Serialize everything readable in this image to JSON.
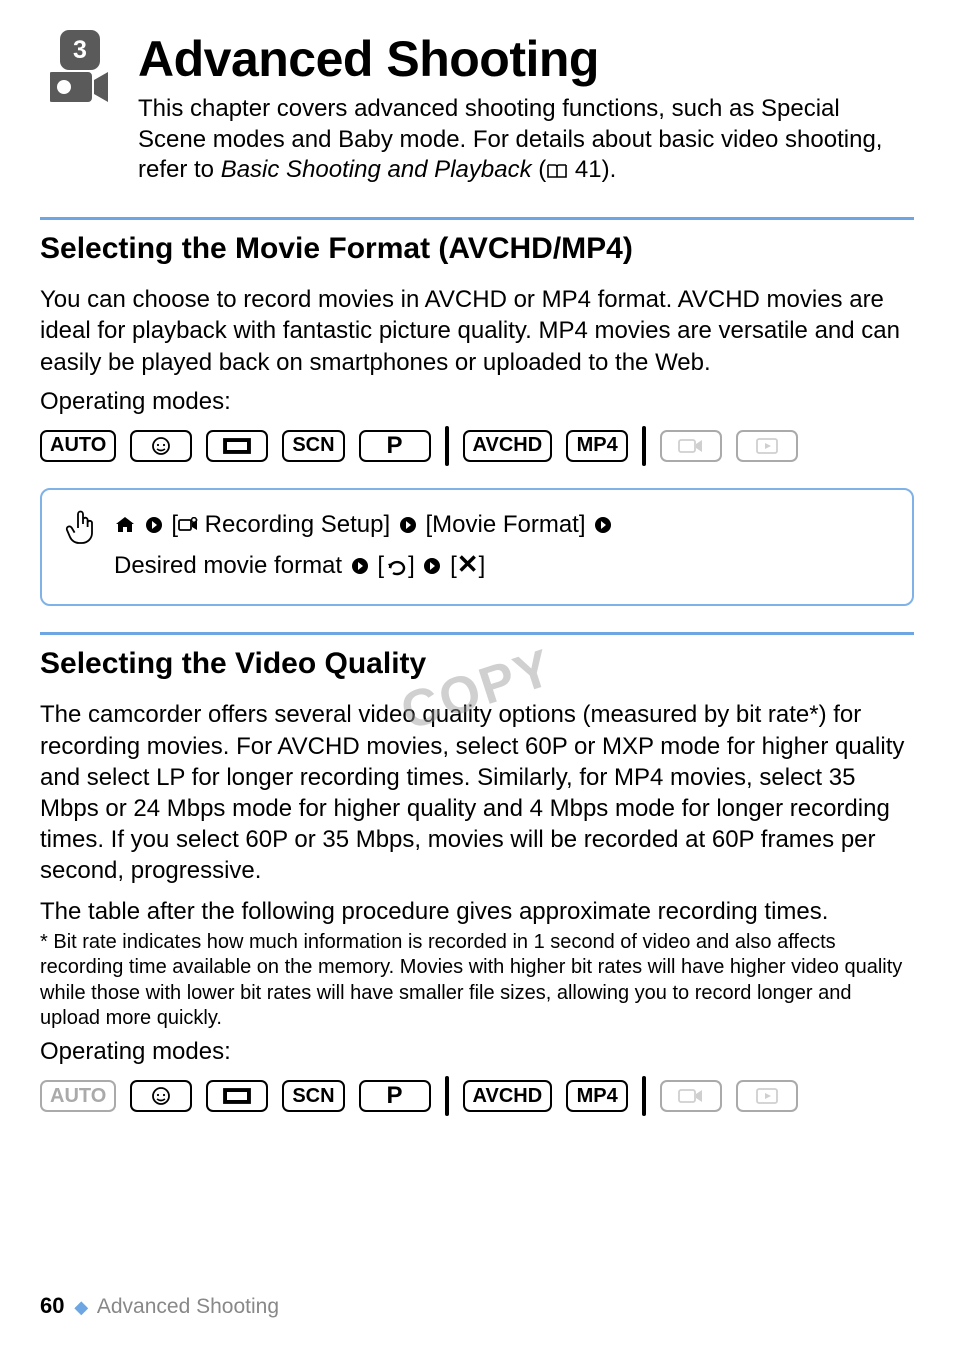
{
  "chapter": {
    "number": "3",
    "title": "Advanced Shooting",
    "intro_pre": "This chapter covers advanced shooting functions, such as Special Scene modes and Baby mode. For details about basic video shooting, refer to ",
    "intro_italic": "Basic Shooting and Playback",
    "intro_post_open": " (",
    "intro_ref": " 41).",
    "crumb": "Advanced Shooting"
  },
  "section1": {
    "title": "Selecting the Movie Format (AVCHD/MP4)",
    "body": "You can choose to record movies in AVCHD or MP4 format. AVCHD movies are ideal for playback with fantastic picture quality. MP4 movies are versatile and can easily be played back on smartphones or uploaded to the Web.",
    "modes_label": "Operating modes:",
    "inset": {
      "rec_setup": " Recording Setup]",
      "movie_format": "[Movie Format]",
      "line2_pre": "Desired movie format ",
      "back_btn": "[",
      "back_post": "]",
      "close_btn": "[",
      "close_glyph": "✕",
      "close_post": "]"
    }
  },
  "section2": {
    "title": "Selecting the Video Quality",
    "body1": "The camcorder offers several video quality options (measured by bit rate*) for recording movies. For AVCHD movies, select 60P or MXP mode for higher quality and select LP for longer recording times. Similarly, for MP4 movies, select 35 Mbps or 24 Mbps mode for higher quality and 4 Mbps mode for longer recording times. If you select 60P or 35 Mbps, movies will be recorded at 60P frames per second, progressive.",
    "body2": "The table after the following procedure gives approximate recording times.",
    "footnote_mark": "*",
    "footnote": " Bit rate indicates how much information is recorded in 1 second of video and also affects recording time available on the memory. Movies with higher bit rates will have higher video quality while those with lower bit rates will have smaller file sizes, allowing you to record longer and upload more quickly.",
    "modes_label": "Operating modes:"
  },
  "modes": {
    "auto": "AUTO",
    "baby": "baby-face-icon",
    "cinema": "cinema-icon",
    "scn": "SCN",
    "p": "P",
    "avchd": "AVCHD",
    "mp4": "MP4",
    "movie_mode": "movie-mode-icon",
    "play": "play-icon"
  },
  "watermark": "COPY",
  "page_number": "60",
  "diamond": "◆"
}
